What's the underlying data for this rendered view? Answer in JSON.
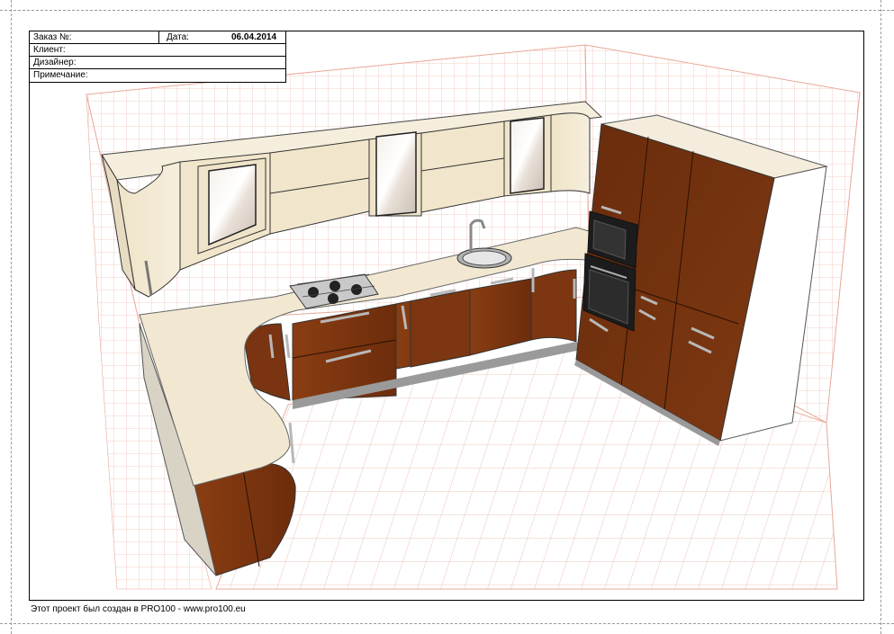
{
  "title_block": {
    "order_label": "Заказ №:",
    "date_label": "Дата:",
    "date_value": "06.04.2014",
    "client_label": "Клиент:",
    "designer_label": "Дизайнер:",
    "note_label": "Примечание:"
  },
  "footer": {
    "text": "Этот проект был создан в PRO100 - www.pro100.eu"
  },
  "colors": {
    "countertop": "#f2e8d2",
    "upper_cabinets": "#f1e7cf",
    "lower_cabinets": "#7a3510",
    "tall_cabinets": "#6e2f0e",
    "grid_lines": "#e9b7a8",
    "appliance": "#1c1c1c"
  },
  "icons": [
    "stove-hob-icon",
    "sink-icon",
    "faucet-icon",
    "oven-icon",
    "microwave-icon"
  ]
}
